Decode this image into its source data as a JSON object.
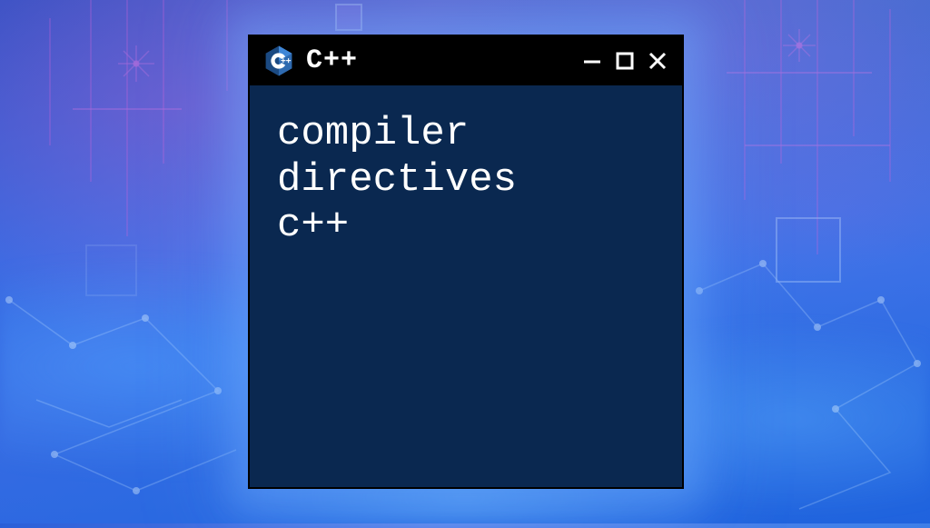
{
  "window": {
    "title": "C++",
    "logo_icon": "cpp-hexagon-icon"
  },
  "content": {
    "line1": "compiler",
    "line2": "directives",
    "line3": "c++"
  },
  "colors": {
    "titlebar_bg": "#000000",
    "content_bg": "#0a2850",
    "text": "#ffffff",
    "logo_blue": "#2a5a9e",
    "logo_lightblue": "#4a8fd0"
  }
}
